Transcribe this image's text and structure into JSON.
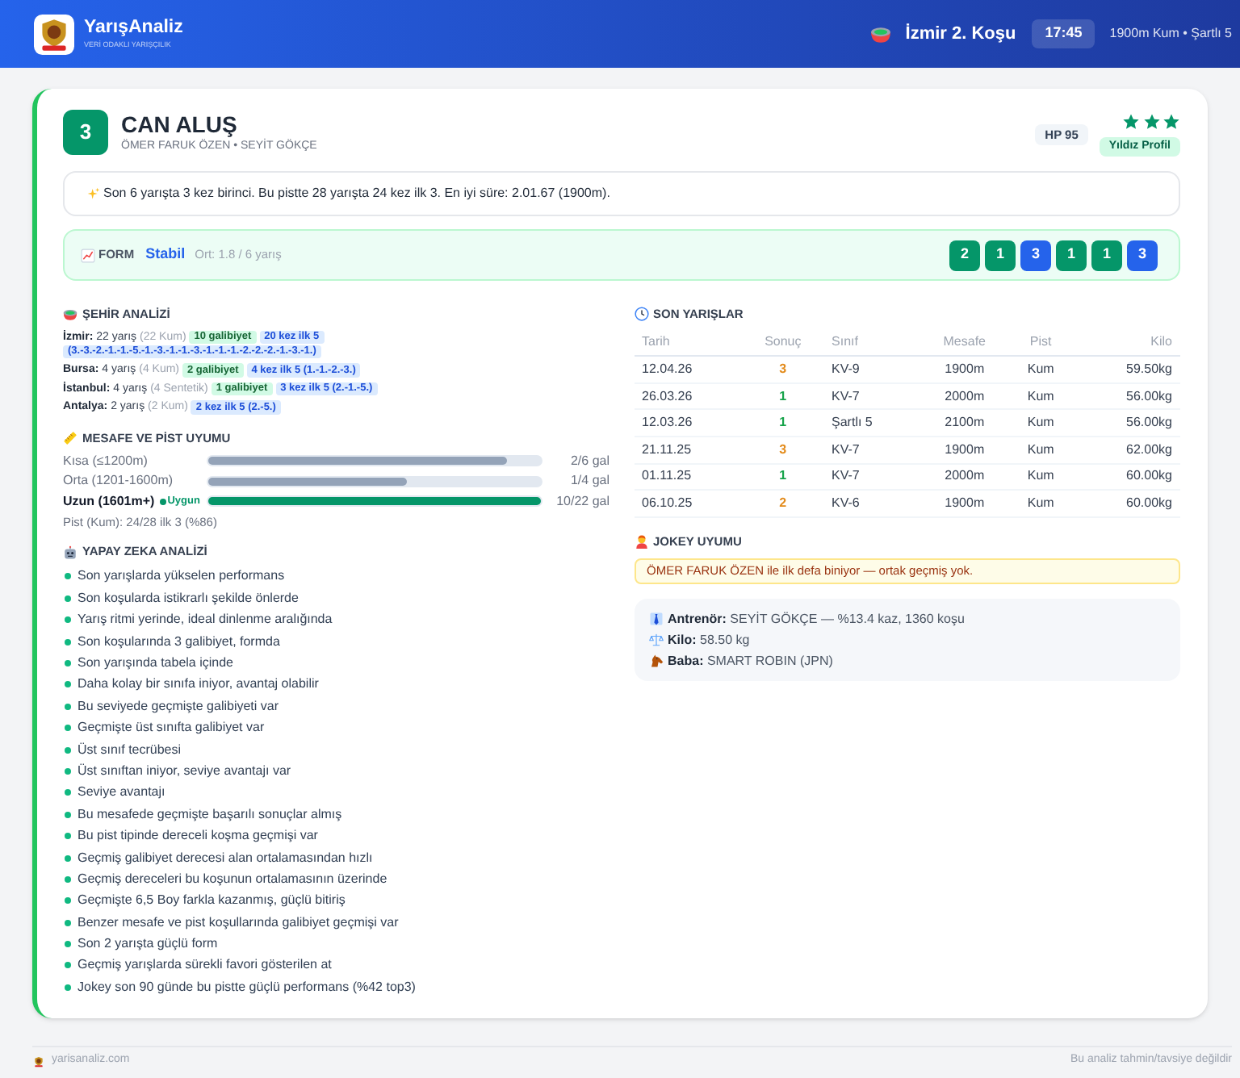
{
  "header": {
    "brand": "YarışAnaliz",
    "tagline": "VERİ ODAKLI YARIŞÇILIK",
    "race": "İzmir 2. Koşu",
    "time": "17:45",
    "details": "1900m Kum • Şartlı 5"
  },
  "horse": {
    "number": "3",
    "name": "CAN ALUŞ",
    "people": "ÖMER FARUK ÖZEN • SEYİT GÖKÇE",
    "hp": "HP 95",
    "stars": 3,
    "profile": "Yıldız Profil"
  },
  "summary": "Son 6 yarışta 3 kez birinci. Bu pistte 28 yarışta 24 kez ilk 3. En iyi süre: 2.01.67 (1900m).",
  "form": {
    "label": "FORM",
    "trend": "Stabil",
    "average": "Ort: 1.8 / 6 yarış",
    "results": [
      {
        "place": "2",
        "color": "#059669"
      },
      {
        "place": "1",
        "color": "#059669"
      },
      {
        "place": "3",
        "color": "#2563eb"
      },
      {
        "place": "1",
        "color": "#059669"
      },
      {
        "place": "1",
        "color": "#059669"
      },
      {
        "place": "3",
        "color": "#2563eb"
      }
    ]
  },
  "city_analysis": {
    "title": "ŞEHİR ANALİZİ",
    "rows": [
      {
        "city": "İzmir:",
        "races": "22 yarış",
        "surface": "(22 Kum)",
        "wins": "10 galibiyet",
        "top5": [
          "20 kez ilk 5",
          "(3.-3.-2.-1.-1.-5.-1.-3.-1.-1.-3.-1.-1.-1.-2.-2.-2.-1.-3.-1.)"
        ]
      },
      {
        "city": "Bursa:",
        "races": "4 yarış",
        "surface": "(4 Kum)",
        "wins": "2 galibiyet",
        "top5": [
          "4 kez ilk 5 (1.-1.-2.-3.)"
        ]
      },
      {
        "city": "İstanbul:",
        "races": "4 yarış",
        "surface": "(4 Sentetik)",
        "wins": "1 galibiyet",
        "top5": [
          "3 kez ilk 5 (2.-1.-5.)"
        ]
      },
      {
        "city": "Antalya:",
        "races": "2 yarış",
        "surface": "(2 Kum)",
        "top5": [
          "2 kez ilk 5 (2.-5.)"
        ]
      }
    ]
  },
  "distance_fit": {
    "title": "MESAFE VE PİST UYUMU",
    "rows": [
      {
        "label": "Kısa (≤1200m)",
        "level": 0.9,
        "reading": "2/6 gal",
        "suitable": false
      },
      {
        "label": "Orta (1201-1600m)",
        "level": 0.6,
        "reading": "1/4 gal",
        "suitable": false
      },
      {
        "label": "Uzun (1601m+)",
        "level": 1,
        "reading": "10/22 gal",
        "suitable": true,
        "status": "Uygun"
      }
    ],
    "track_note": "Pist (Kum): 24/28 ilk 3 (%86)"
  },
  "ai_analysis": {
    "title": "YAPAY ZEKA ANALİZİ",
    "items": [
      "Son yarışlarda yükselen performans",
      "Son koşularda istikrarlı şekilde önlerde",
      "Yarış ritmi yerinde, ideal dinlenme aralığında",
      "Son koşularında 3 galibiyet, formda",
      "Son yarışında tabela içinde",
      "Daha kolay bir sınıfa iniyor, avantaj olabilir",
      "Bu seviyede geçmişte galibiyeti var",
      "Geçmişte üst sınıfta galibiyet var",
      "Üst sınıf tecrübesi",
      "Üst sınıftan iniyor, seviye avantajı var",
      "Seviye avantajı",
      "Bu mesafede geçmişte başarılı sonuçlar almış",
      "Bu pist tipinde dereceli koşma geçmişi var",
      "Geçmiş galibiyet derecesi alan ortalamasından hızlı",
      "Geçmiş dereceleri bu koşunun ortalamasının üzerinde",
      "Geçmişte 6,5 Boy farkla kazanmış, güçlü bitiriş",
      "Benzer mesafe ve pist koşullarında galibiyet geçmişi var",
      "Son 2 yarışta güçlü form",
      "Geçmiş yarışlarda sürekli favori gösterilen at",
      "Jokey son 90 günde bu pistte güçlü performans (%42 top3)"
    ]
  },
  "recent_races": {
    "title": "SON YARIŞLAR",
    "columns": [
      "Tarih",
      "Sonuç",
      "Sınıf",
      "Mesafe",
      "Pist",
      "Kilo"
    ],
    "rows": [
      {
        "date": "12.04.26",
        "result": "3",
        "color": "#e38b1b",
        "class": "KV-9",
        "distance": "1900m",
        "track": "Kum",
        "weight": "59.50kg"
      },
      {
        "date": "26.03.26",
        "result": "1",
        "color": "#16a34a",
        "class": "KV-7",
        "distance": "2000m",
        "track": "Kum",
        "weight": "56.00kg"
      },
      {
        "date": "12.03.26",
        "result": "1",
        "color": "#16a34a",
        "class": "Şartlı 5",
        "distance": "2100m",
        "track": "Kum",
        "weight": "56.00kg"
      },
      {
        "date": "21.11.25",
        "result": "3",
        "color": "#e38b1b",
        "class": "KV-7",
        "distance": "1900m",
        "track": "Kum",
        "weight": "62.00kg"
      },
      {
        "date": "01.11.25",
        "result": "1",
        "color": "#16a34a",
        "class": "KV-7",
        "distance": "2000m",
        "track": "Kum",
        "weight": "60.00kg"
      },
      {
        "date": "06.10.25",
        "result": "2",
        "color": "#e38b1b",
        "class": "KV-6",
        "distance": "1900m",
        "track": "Kum",
        "weight": "60.00kg"
      }
    ]
  },
  "jockey_fit": {
    "title": "JOKEY UYUMU",
    "notice": "ÖMER FARUK ÖZEN ile ilk defa biniyor — ortak geçmiş yok."
  },
  "details": [
    {
      "kind": "trainer",
      "label": "Antrenör:",
      "value": "SEYİT GÖKÇE — %13.4 kaz, 1360 koşu"
    },
    {
      "kind": "weight",
      "label": "Kilo:",
      "value": "58.50 kg"
    },
    {
      "kind": "sire",
      "label": "Baba:",
      "value": "SMART ROBIN (JPN)"
    }
  ],
  "footer": {
    "site": "yarisanaliz.com",
    "disclaimer": "Bu analiz tahmin/tavsiye değildir"
  }
}
